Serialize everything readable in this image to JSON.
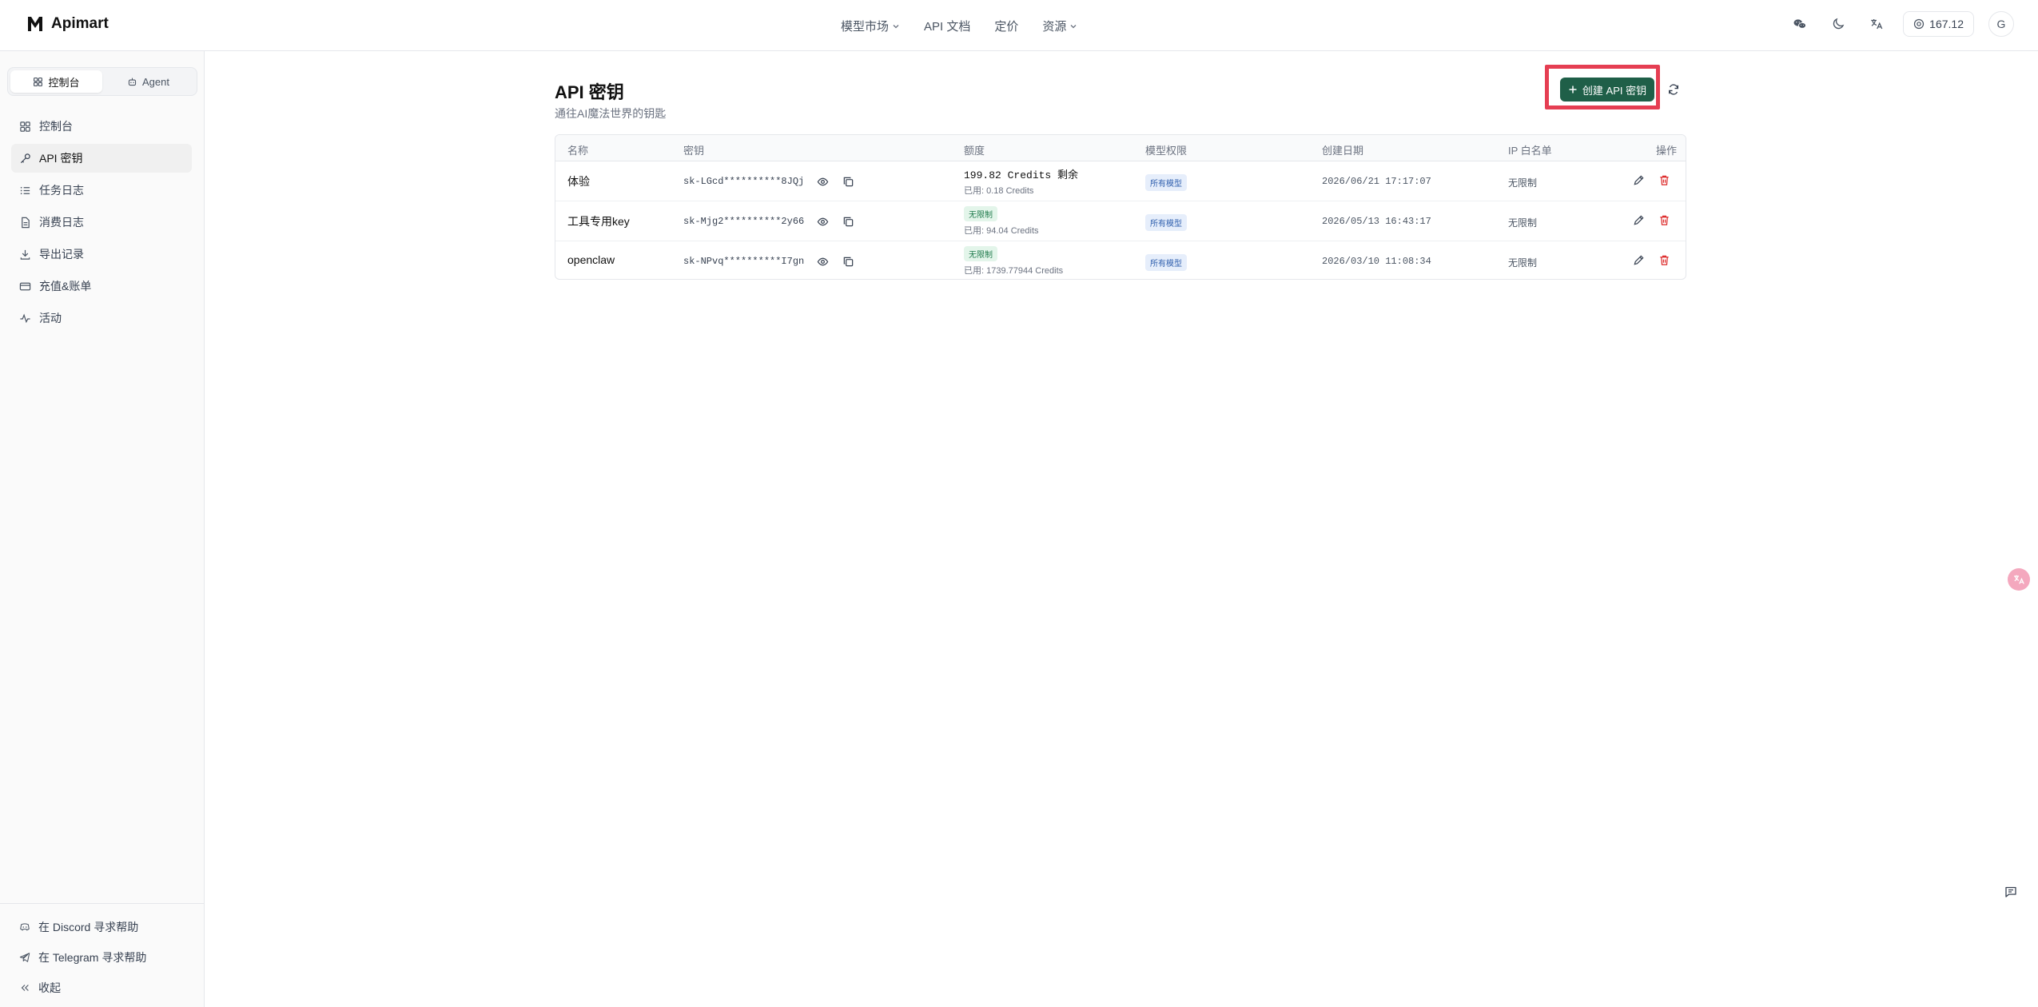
{
  "app": {
    "name": "Apimart"
  },
  "nav": {
    "items": [
      {
        "label": "模型市场",
        "has_dropdown": true
      },
      {
        "label": "API 文档",
        "has_dropdown": false
      },
      {
        "label": "定价",
        "has_dropdown": false
      },
      {
        "label": "资源",
        "has_dropdown": true
      }
    ]
  },
  "header": {
    "balance": "167.12",
    "avatar": "G"
  },
  "sidebar": {
    "tabs": [
      {
        "label": "控制台",
        "active": true
      },
      {
        "label": "Agent",
        "active": false
      }
    ],
    "items": [
      {
        "label": "控制台",
        "icon": "grid-icon",
        "active": false
      },
      {
        "label": "API 密钥",
        "icon": "key-icon",
        "active": true
      },
      {
        "label": "任务日志",
        "icon": "list-icon",
        "active": false
      },
      {
        "label": "消费日志",
        "icon": "file-icon",
        "active": false
      },
      {
        "label": "导出记录",
        "icon": "download-icon",
        "active": false
      },
      {
        "label": "充值&账单",
        "icon": "card-icon",
        "active": false
      },
      {
        "label": "活动",
        "icon": "activity-icon",
        "active": false
      }
    ],
    "bottom": {
      "discord": "在 Discord 寻求帮助",
      "telegram": "在 Telegram 寻求帮助",
      "collapse": "收起"
    }
  },
  "page": {
    "title": "API 密钥",
    "subtitle": "通往AI魔法世界的钥匙",
    "create_button": "创建 API 密钥"
  },
  "table": {
    "columns": [
      "名称",
      "密钥",
      "额度",
      "模型权限",
      "创建日期",
      "IP 白名单",
      "操作"
    ],
    "rows": [
      {
        "name": "体验",
        "key": "sk-LGcd**********8JQj",
        "quota_main": "199.82 Credits 剩余",
        "quota_unlimited": false,
        "quota_used": "已用: 0.18 Credits",
        "permission": "所有模型",
        "created": "2026/06/21 17:17:07",
        "ip": "无限制"
      },
      {
        "name": "工具专用key",
        "key": "sk-Mjg2**********2y66",
        "quota_main": "无限制",
        "quota_unlimited": true,
        "quota_used": "已用: 94.04 Credits",
        "permission": "所有模型",
        "created": "2026/05/13 16:43:17",
        "ip": "无限制"
      },
      {
        "name": "openclaw",
        "key": "sk-NPvq**********I7gn",
        "quota_main": "无限制",
        "quota_unlimited": true,
        "quota_used": "已用: 1739.77944 Credits",
        "permission": "所有模型",
        "created": "2026/03/10 11:08:34",
        "ip": "无限制"
      }
    ]
  },
  "colors": {
    "primary": "#1f5f48",
    "highlight": "#e53e52",
    "danger": "#dc2626"
  }
}
